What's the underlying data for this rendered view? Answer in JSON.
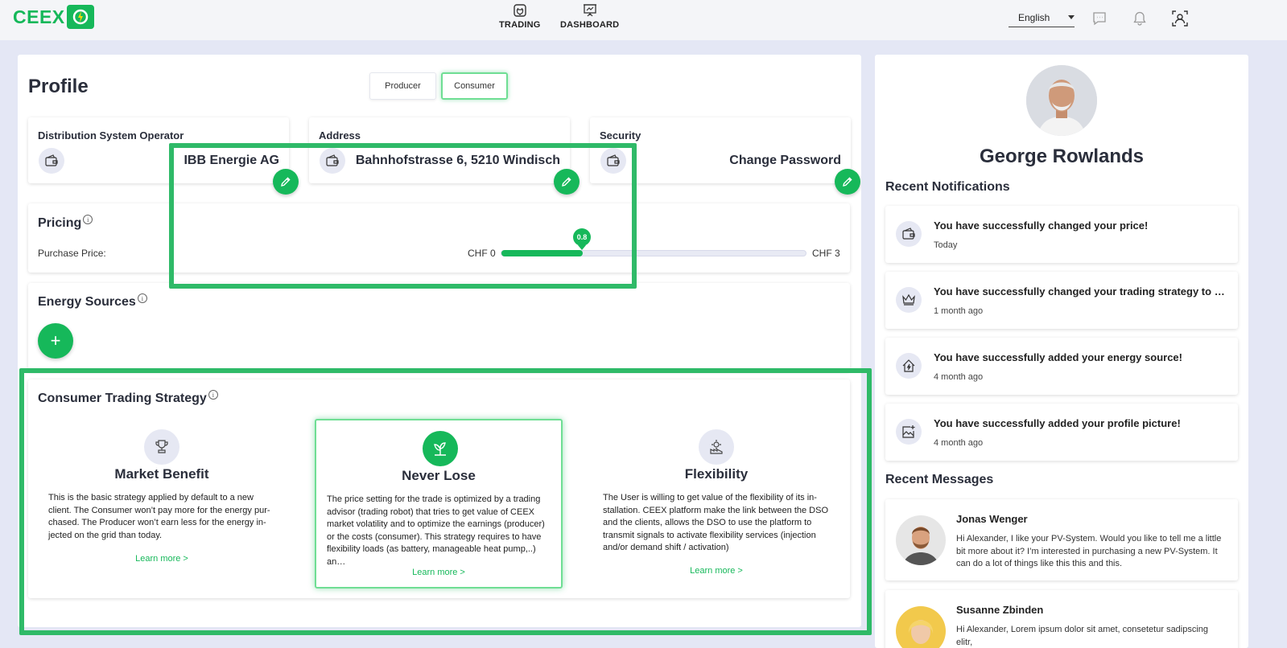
{
  "app": {
    "logo_text": "CEEX"
  },
  "nav": [
    {
      "label": "TRADING",
      "icon": "trading-plug-icon"
    },
    {
      "label": "DASHBOARD",
      "icon": "dashboard-presentation-icon"
    }
  ],
  "language": {
    "selected": "English"
  },
  "header_icons": [
    "chat-icon",
    "bell-icon",
    "account-icon"
  ],
  "profile": {
    "title": "Profile",
    "roles": [
      "Producer",
      "Consumer"
    ],
    "active_role": "Consumer",
    "cards": {
      "dso": {
        "label": "Distribution System Operator",
        "value": "IBB Energie AG"
      },
      "address": {
        "label": "Address",
        "value": "Bahnhofstrasse 6, 5210 Windisch"
      },
      "security": {
        "label": "Security",
        "value": "Change Password"
      }
    },
    "pricing": {
      "title": "Pricing",
      "purchase_label": "Purchase Price:",
      "min_label": "CHF 0",
      "max_label": "CHF 3",
      "value_label": "0.8",
      "min": 0,
      "max": 3,
      "value": 0.8
    },
    "energy_sources": {
      "title": "Energy Sources",
      "add_label": "+"
    },
    "strategy": {
      "title": "Consumer Trading Strategy",
      "options": [
        {
          "title": "Market Benefit",
          "description": "This is the basic strategy applied by default to a new client. The Consumer won’t pay more for the energy pur- chased. The Producer won’t earn less for the energy in- jected on the grid than today.",
          "link": "Learn more >"
        },
        {
          "title": "Never Lose",
          "description": "The price setting for the trade is optimized by a trading advisor (trading robot) that tries to get value of CEEX market volatility and to optimize the earnings (producer) or the costs (consumer). This strategy requires to have flexibility loads (as battery, manageable heat pump,..) an…",
          "link": "Learn more >"
        },
        {
          "title": "Flexibility",
          "description": "The User is willing to get value of the flexibility of its in- stallation. CEEX platform make the link between the DSO and the clients, allows the DSO to use the platform to transmit signals to activate flexibility services (injection and/or demand shift / activation)",
          "link": "Learn more >"
        }
      ],
      "selected": "Never Lose"
    }
  },
  "user": {
    "name": "George Rowlands"
  },
  "notifications": {
    "title": "Recent Notifications",
    "items": [
      {
        "text": "You have successfully changed your price!",
        "time": "Today",
        "icon": "wallet-icon"
      },
      {
        "text": "You have successfully changed your trading strategy to m...",
        "time": "1 month ago",
        "icon": "crown-icon"
      },
      {
        "text": "You have successfully added your energy source!",
        "time": "4 month ago",
        "icon": "energy-house-icon"
      },
      {
        "text": "You have successfully added your profile picture!",
        "time": "4 month ago",
        "icon": "image-add-icon"
      }
    ]
  },
  "messages": {
    "title": "Recent Messages",
    "items": [
      {
        "name": "Jonas Wenger",
        "text": "Hi Alexander, I like your PV-System. Would you like to tell me a little bit more about it? I’m interested in purchasing a new PV-System. It can do a lot of things like this this and this."
      },
      {
        "name": "Susanne Zbinden",
        "text": "Hi Alexander, Lorem ipsum dolor sit amet, consetetur sadipscing elitr,"
      }
    ]
  },
  "colors": {
    "accent": "#16b85a",
    "highlight": "#2fba68",
    "background": "#e4e7f5"
  }
}
